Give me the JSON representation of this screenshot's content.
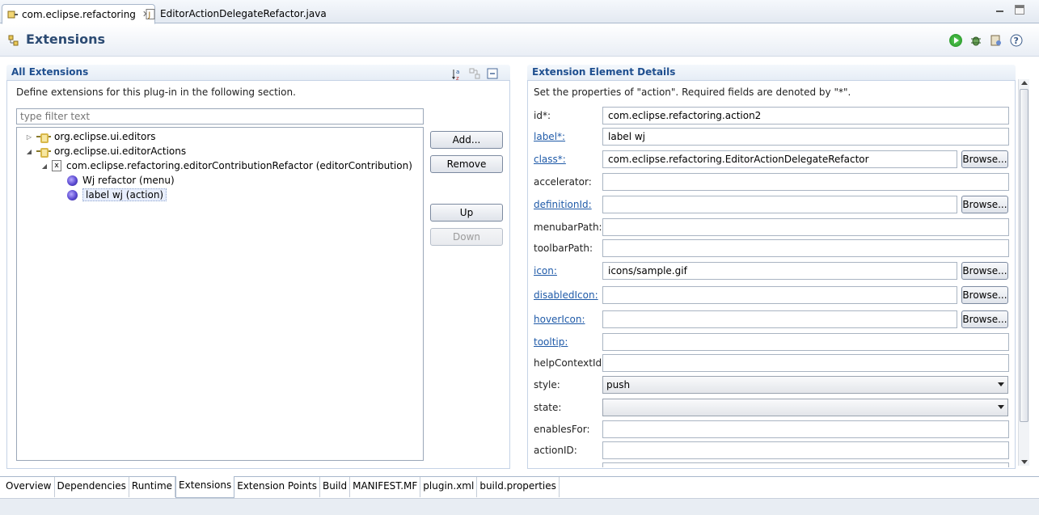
{
  "editor_tabs": [
    {
      "label": "com.eclipse.refactoring",
      "active": true
    },
    {
      "label": "EditorActionDelegateRefactor.java",
      "active": false
    }
  ],
  "header": {
    "title": "Extensions"
  },
  "all_extensions": {
    "title": "All Extensions",
    "description": "Define extensions for this plug-in in the following section.",
    "filter_placeholder": "type filter text",
    "tree": [
      {
        "label": "org.eclipse.ui.editors",
        "expanded": false
      },
      {
        "label": "org.eclipse.ui.editorActions",
        "expanded": true
      },
      {
        "label": "com.eclipse.refactoring.editorContributionRefactor (editorContribution)",
        "expanded": true
      },
      {
        "label": "Wj refactor (menu)"
      },
      {
        "label": "label wj (action)",
        "selected": true
      }
    ],
    "buttons": {
      "add": "Add...",
      "remove": "Remove",
      "up": "Up",
      "down": "Down"
    }
  },
  "details": {
    "title": "Extension Element Details",
    "description": "Set the properties of \"action\". Required fields are denoted by \"*\".",
    "browse_label": "Browse...",
    "fields": {
      "id": {
        "label": "id*:",
        "value": "com.eclipse.refactoring.action2"
      },
      "label": {
        "label": "label*:",
        "value": "label wj"
      },
      "class": {
        "label": "class*:",
        "value": "com.eclipse.refactoring.EditorActionDelegateRefactor"
      },
      "accelerator": {
        "label": "accelerator:",
        "value": ""
      },
      "definitionId": {
        "label": "definitionId:",
        "value": ""
      },
      "menubarPath": {
        "label": "menubarPath:",
        "value": ""
      },
      "toolbarPath": {
        "label": "toolbarPath:",
        "value": ""
      },
      "icon": {
        "label": "icon:",
        "value": "icons/sample.gif"
      },
      "disabledIcon": {
        "label": "disabledIcon:",
        "value": ""
      },
      "hoverIcon": {
        "label": "hoverIcon:",
        "value": ""
      },
      "tooltip": {
        "label": "tooltip:",
        "value": ""
      },
      "helpContextId": {
        "label": "helpContextId:",
        "value": ""
      },
      "style": {
        "label": "style:",
        "value": "push"
      },
      "state": {
        "label": "state:",
        "value": ""
      },
      "enablesFor": {
        "label": "enablesFor:",
        "value": ""
      },
      "actionID": {
        "label": "actionID:",
        "value": ""
      }
    }
  },
  "page_tabs": [
    {
      "label": "Overview"
    },
    {
      "label": "Dependencies"
    },
    {
      "label": "Runtime"
    },
    {
      "label": "Extensions",
      "active": true
    },
    {
      "label": "Extension Points"
    },
    {
      "label": "Build"
    },
    {
      "label": "MANIFEST.MF"
    },
    {
      "label": "plugin.xml"
    },
    {
      "label": "build.properties"
    }
  ],
  "colors": {
    "accent": "#2c4b73",
    "link": "#1f5aa8",
    "section_title": "#1f4f8f"
  }
}
